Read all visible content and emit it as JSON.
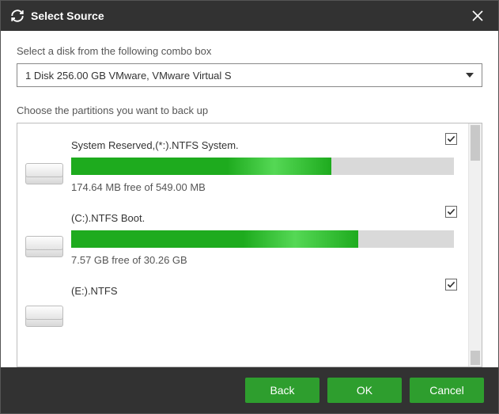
{
  "titlebar": {
    "title": "Select Source"
  },
  "labels": {
    "disk_select": "Select a disk from the following combo box",
    "partitions": "Choose the partitions you want to back up"
  },
  "combo": {
    "selected": "1 Disk 256.00 GB VMware,  VMware Virtual S"
  },
  "partitions": [
    {
      "name": "System Reserved,(*:).NTFS System.",
      "free_text": "174.64 MB free of 549.00 MB",
      "used_percent": 68,
      "checked": true
    },
    {
      "name": "(C:).NTFS Boot.",
      "free_text": "7.57 GB free of 30.26 GB",
      "used_percent": 75,
      "checked": true
    },
    {
      "name": "(E:).NTFS",
      "free_text": "",
      "used_percent": 0,
      "checked": true
    }
  ],
  "buttons": {
    "back": "Back",
    "ok": "OK",
    "cancel": "Cancel"
  }
}
